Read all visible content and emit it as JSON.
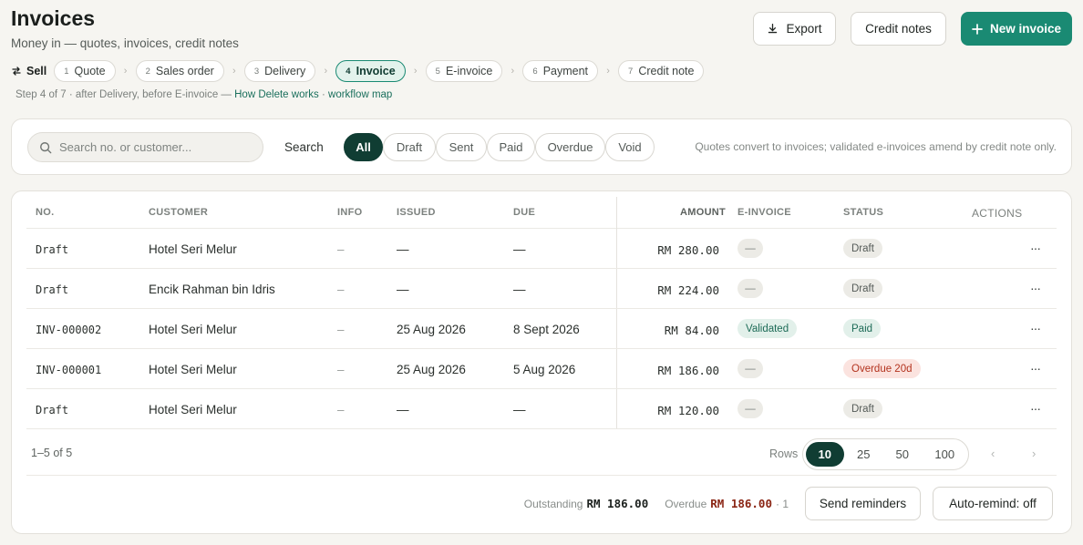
{
  "header": {
    "title": "Invoices",
    "subtitle": "Money in — quotes, invoices, credit notes",
    "export_label": "Export",
    "credit_notes_label": "Credit notes",
    "new_invoice_label": "New invoice"
  },
  "workflow": {
    "section": "Sell",
    "steps": [
      {
        "num": "1",
        "label": "Quote"
      },
      {
        "num": "2",
        "label": "Sales order"
      },
      {
        "num": "3",
        "label": "Delivery"
      },
      {
        "num": "4",
        "label": "Invoice"
      },
      {
        "num": "5",
        "label": "E-invoice"
      },
      {
        "num": "6",
        "label": "Payment"
      },
      {
        "num": "7",
        "label": "Credit note"
      }
    ],
    "active_step": 4,
    "note_prefix": "Step 4 of 7 · after Delivery, before E-invoice — ",
    "note_link1": "How Delete works",
    "note_sep": " · ",
    "note_link2": "workflow map"
  },
  "filters": {
    "search_placeholder": "Search no. or customer...",
    "search_label": "Search",
    "tabs": [
      "All",
      "Draft",
      "Sent",
      "Paid",
      "Overdue",
      "Void"
    ],
    "active_tab": "All",
    "note": "Quotes convert to invoices; validated e-invoices amend by credit note only."
  },
  "table": {
    "columns": {
      "no": "NO.",
      "customer": "CUSTOMER",
      "info": "INFO",
      "issued": "ISSUED",
      "due": "DUE",
      "amount": "AMOUNT",
      "einvoice": "E-INVOICE",
      "status": "STATUS",
      "actions": "ACTIONS"
    },
    "rows": [
      {
        "no": "Draft",
        "customer": "Hotel Seri Melur",
        "info": "–",
        "issued": "—",
        "due": "—",
        "amount": "RM 280.00",
        "einvoice": "—",
        "status": "Draft"
      },
      {
        "no": "Draft",
        "customer": "Encik Rahman bin Idris",
        "info": "–",
        "issued": "—",
        "due": "—",
        "amount": "RM 224.00",
        "einvoice": "—",
        "status": "Draft"
      },
      {
        "no": "INV-000002",
        "customer": "Hotel Seri Melur",
        "info": "–",
        "issued": "25 Aug 2026",
        "due": "8 Sept 2026",
        "amount": "RM 84.00",
        "einvoice": "Validated",
        "status": "Paid"
      },
      {
        "no": "INV-000001",
        "customer": "Hotel Seri Melur",
        "info": "–",
        "issued": "25 Aug 2026",
        "due": "5 Aug 2026",
        "amount": "RM 186.00",
        "einvoice": "—",
        "status": "Overdue 20d"
      },
      {
        "no": "Draft",
        "customer": "Hotel Seri Melur",
        "info": "–",
        "issued": "—",
        "due": "—",
        "amount": "RM 120.00",
        "einvoice": "—",
        "status": "Draft"
      }
    ],
    "more_glyph": "···"
  },
  "pagination": {
    "range": "1–5 of 5",
    "rows_label": "Rows",
    "options": [
      "10",
      "25",
      "50",
      "100"
    ],
    "selected": "10",
    "prev": "‹",
    "next": "›"
  },
  "summary": {
    "outstanding_label": "Outstanding",
    "outstanding_value": "RM 186.00",
    "overdue_label": "Overdue",
    "overdue_value": "RM 186.00",
    "overdue_count": "· 1",
    "send_reminders_label": "Send reminders",
    "auto_remind_label": "Auto-remind: off"
  },
  "colors": {
    "accent": "#1a8a73",
    "dark_accent": "#103d33",
    "overdue": "#b3331e",
    "background": "#f6f5f1"
  },
  "icons": [
    "download-icon",
    "plus-icon",
    "sell-icon",
    "chevron-right-icon",
    "search-icon",
    "more-horizontal-icon"
  ]
}
